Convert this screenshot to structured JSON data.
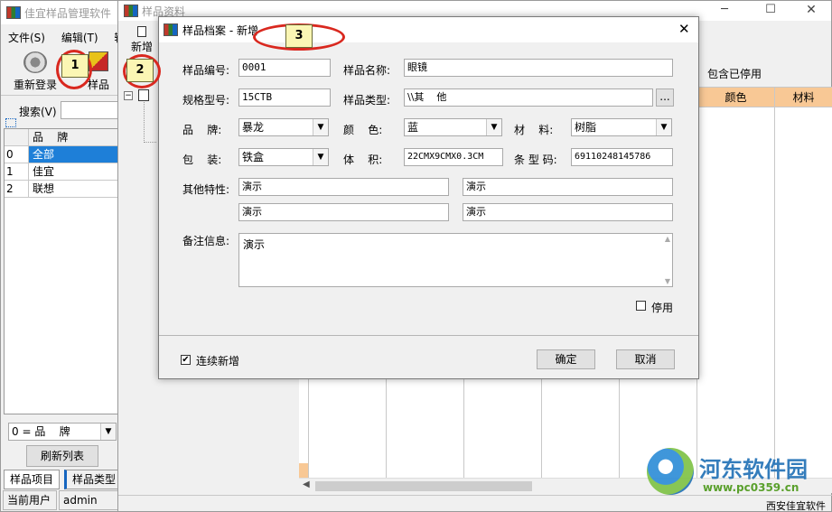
{
  "main_window": {
    "title": "佳宜样品管理软件",
    "menu": [
      "文件(S)",
      "编辑(T)",
      "输"
    ],
    "toolbar": {
      "relogin": "重新登录",
      "samples": "样品"
    },
    "search_label": "搜索(V)",
    "brand_table": {
      "headers": [
        "",
        "品    牌"
      ],
      "rows": [
        {
          "idx": "0",
          "name": "全部"
        },
        {
          "idx": "1",
          "name": "佳宜"
        },
        {
          "idx": "2",
          "name": "联想"
        }
      ]
    },
    "filter_select": "0 = 品    牌",
    "refresh_button": "刷新列表",
    "bottom_tabs": [
      "样品项目",
      "样品类型"
    ],
    "status": {
      "label": "当前用户",
      "user": "admin"
    }
  },
  "sample_window": {
    "title": "样品资料",
    "toolbar_new": "新增",
    "include_disabled": "包含已停用",
    "col_headers": [
      "颜色",
      "材料"
    ],
    "status_right": "西安佳宜软件"
  },
  "dialog": {
    "title": "样品档案 - 新增",
    "close": "✕",
    "fields": {
      "code_label": "样品编号:",
      "code": "0001",
      "name_label": "样品名称:",
      "name": "眼镜",
      "model_label": "规格型号:",
      "model": "15CTB",
      "type_label": "样品类型:",
      "type": "\\\\其    他",
      "type_btn": "...",
      "brand_label": "品    牌:",
      "brand": "暴龙",
      "color_label": "颜    色:",
      "color": "蓝",
      "material_label": "材    料:",
      "material": "树脂",
      "pack_label": "包    装:",
      "pack": "铁盒",
      "volume_label": "体    积:",
      "volume": "22CMX9CMX0.3CM",
      "barcode_label": "条 型 码:",
      "barcode": "69110248145786",
      "other_label": "其他特性:",
      "other": [
        "演示",
        "演示",
        "演示",
        "演示"
      ],
      "remark_label": "备注信息:",
      "remark": "演示"
    },
    "disabled_label": "停用",
    "continuous_label": "连续新增",
    "ok": "确定",
    "cancel": "取消"
  },
  "annotations": [
    "1",
    "2",
    "3"
  ],
  "watermark": {
    "name": "河东软件园",
    "url": "www.pc0359.cn"
  }
}
